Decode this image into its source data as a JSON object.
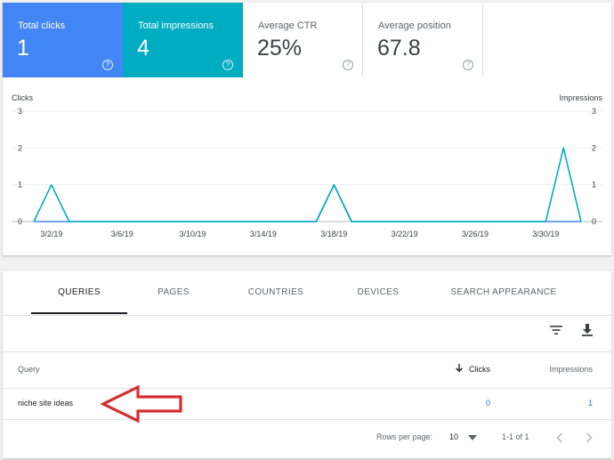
{
  "metrics": [
    {
      "label": "Total clicks",
      "value": "1"
    },
    {
      "label": "Total impressions",
      "value": "4"
    },
    {
      "label": "Average CTR",
      "value": "25%"
    },
    {
      "label": "Average position",
      "value": "67.8"
    }
  ],
  "help_glyph": "?",
  "chart_data": {
    "type": "line",
    "left_axis_label": "Clicks",
    "right_axis_label": "Impressions",
    "y_ticks": [
      "0",
      "1",
      "2",
      "3"
    ],
    "ylim": [
      0,
      3
    ],
    "x_tick_labels": [
      "3/2/19",
      "3/6/19",
      "3/10/19",
      "3/14/19",
      "3/18/19",
      "3/22/19",
      "3/26/19",
      "3/30/19"
    ],
    "x_dates": [
      "3/1",
      "3/2",
      "3/3",
      "3/4",
      "3/5",
      "3/6",
      "3/7",
      "3/8",
      "3/9",
      "3/10",
      "3/11",
      "3/12",
      "3/13",
      "3/14",
      "3/15",
      "3/16",
      "3/17",
      "3/18",
      "3/19",
      "3/20",
      "3/21",
      "3/22",
      "3/23",
      "3/24",
      "3/25",
      "3/26",
      "3/27",
      "3/28",
      "3/29",
      "3/30",
      "3/31",
      "4/1"
    ],
    "grid": true,
    "series": [
      {
        "name": "Clicks",
        "color": "#4285f4",
        "values": [
          0,
          0,
          0,
          0,
          0,
          0,
          0,
          0,
          0,
          0,
          0,
          0,
          0,
          0,
          0,
          0,
          0,
          1,
          0,
          0,
          0,
          0,
          0,
          0,
          0,
          0,
          0,
          0,
          0,
          0,
          0,
          0
        ]
      },
      {
        "name": "Impressions",
        "color": "#00acc1",
        "values": [
          0,
          1,
          0,
          0,
          0,
          0,
          0,
          0,
          0,
          0,
          0,
          0,
          0,
          0,
          0,
          0,
          0,
          1,
          0,
          0,
          0,
          0,
          0,
          0,
          0,
          0,
          0,
          0,
          0,
          0,
          2,
          0
        ]
      }
    ]
  },
  "tabs": [
    "QUERIES",
    "PAGES",
    "COUNTRIES",
    "DEVICES",
    "SEARCH APPEARANCE"
  ],
  "table": {
    "columns": {
      "query": "Query",
      "clicks": "Clicks",
      "impressions": "Impressions"
    },
    "rows": [
      {
        "query": "niche site ideas",
        "clicks": "0",
        "impressions": "1"
      }
    ]
  },
  "pager": {
    "rows_per_page_label": "Rows per page:",
    "rows_per_page_value": "10",
    "range": "1-1 of 1"
  },
  "colors": {
    "annotation_arrow": "#d32f2f"
  }
}
